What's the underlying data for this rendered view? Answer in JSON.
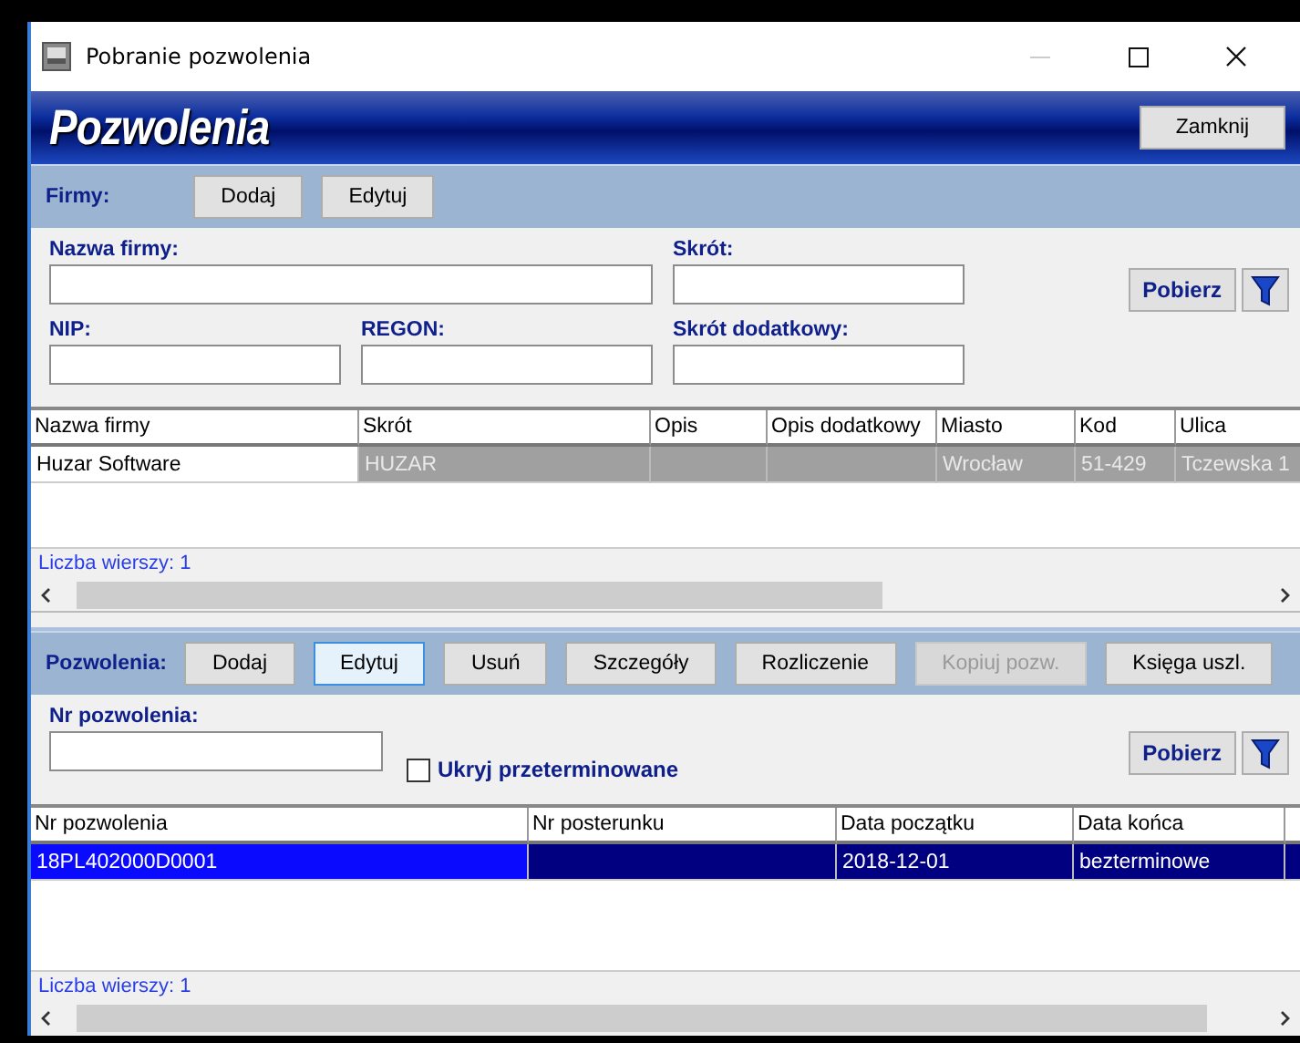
{
  "window": {
    "title": "Pobranie pozwolenia"
  },
  "header": {
    "title": "Pozwolenia",
    "close_button": "Zamknij"
  },
  "firms": {
    "toolbar": {
      "label": "Firmy:",
      "buttons": [
        {
          "label": "Dodaj",
          "disabled": false,
          "focused": false
        },
        {
          "label": "Edytuj",
          "disabled": false,
          "focused": false
        }
      ]
    },
    "filters": [
      {
        "label": "Nazwa firmy:",
        "kind": "wide"
      },
      {
        "label": "Skrót:",
        "kind": "normal"
      },
      {
        "label": "NIP:",
        "kind": "normal"
      },
      {
        "label": "REGON:",
        "kind": "normal"
      },
      {
        "label": "Skrót dodatkowy:",
        "kind": "normal"
      }
    ],
    "fetch_button": "Pobierz",
    "table": {
      "columns": [
        "Nazwa firmy",
        "Skrót",
        "Opis",
        "Opis dodatkowy",
        "Miasto",
        "Kod",
        "Ulica"
      ],
      "rows": [
        {
          "selected": true,
          "cells": [
            "Huzar Software",
            "HUZAR",
            "",
            "",
            "Wrocław",
            "51-429",
            "Tczewska 1"
          ]
        }
      ],
      "row_count": "Liczba wierszy: 1"
    }
  },
  "permits": {
    "toolbar": {
      "label": "Pozwolenia:",
      "buttons": [
        {
          "label": "Dodaj",
          "disabled": false,
          "focused": false
        },
        {
          "label": "Edytuj",
          "disabled": false,
          "focused": true
        },
        {
          "label": "Usuń",
          "disabled": false,
          "focused": false
        },
        {
          "label": "Szczegóły",
          "disabled": false,
          "focused": false
        },
        {
          "label": "Rozliczenie",
          "disabled": false,
          "focused": false
        },
        {
          "label": "Kopiuj pozw.",
          "disabled": true,
          "focused": false
        },
        {
          "label": "Księga uszl.",
          "disabled": false,
          "focused": false
        }
      ]
    },
    "filter": {
      "label": "Nr pozwolenia:"
    },
    "hide_expired": {
      "label": "Ukryj przeterminowane",
      "checked": false
    },
    "fetch_button": "Pobierz",
    "table": {
      "columns": [
        "Nr pozwolenia",
        "Nr posterunku",
        "Data początku",
        "Data końca",
        ""
      ],
      "rows": [
        {
          "selected": true,
          "cells": [
            "18PL402000D0001",
            "",
            "2018-12-01",
            "bezterminowe",
            ""
          ]
        }
      ],
      "row_count": "Liczba wierszy: 1"
    }
  }
}
